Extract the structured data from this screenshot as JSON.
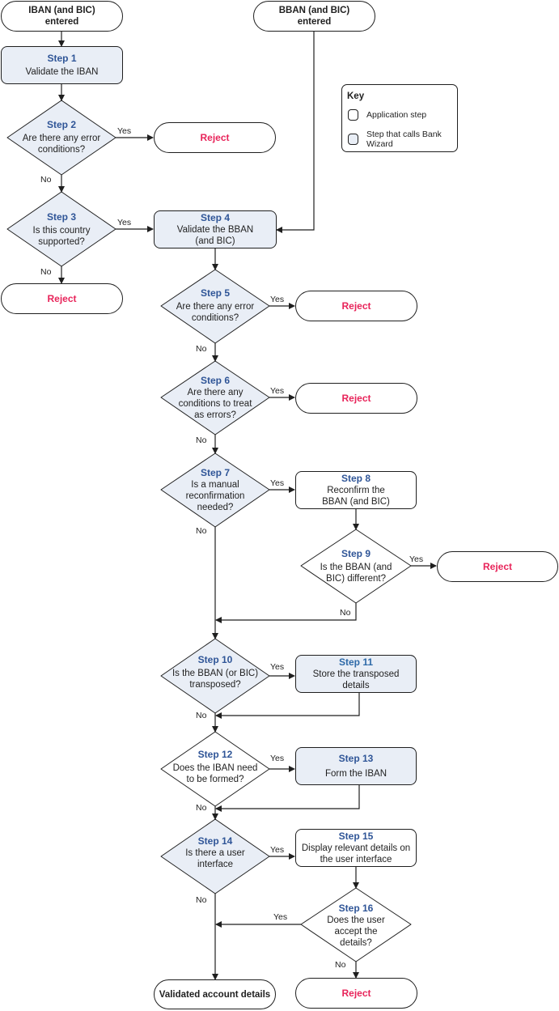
{
  "key": {
    "title": "Key",
    "items": [
      {
        "label": "Application step",
        "fill": "#ffffff"
      },
      {
        "label": "Step that calls Bank Wizard",
        "fill": "#e9eef6"
      }
    ]
  },
  "colors": {
    "bank_wizard_fill": "#e9eef6",
    "step_label": "#2f5597",
    "reject": "#e8245a",
    "line": "#1f1f1f"
  },
  "terminals": {
    "iban_entered": "IBAN (and BIC) entered",
    "bban_entered": "BBAN (and BIC) entered",
    "reject": "Reject",
    "validated": "Validated account details"
  },
  "edge_labels": {
    "yes": "Yes",
    "no": "No"
  },
  "steps": {
    "s1": {
      "step": "Step 1",
      "text": "Validate the IBAN",
      "type": "process",
      "calls_bank_wizard": true
    },
    "s2": {
      "step": "Step 2",
      "text": "Are there any error conditions?",
      "type": "decision",
      "calls_bank_wizard": true
    },
    "s3": {
      "step": "Step 3",
      "text": "Is this country supported?",
      "type": "decision",
      "calls_bank_wizard": true
    },
    "s4": {
      "step": "Step 4",
      "text": "Validate the BBAN (and BIC)",
      "type": "process",
      "calls_bank_wizard": true
    },
    "s5": {
      "step": "Step 5",
      "text": "Are there any error conditions?",
      "type": "decision",
      "calls_bank_wizard": true
    },
    "s6": {
      "step": "Step 6",
      "text": "Are there any conditions to treat as errors?",
      "type": "decision",
      "calls_bank_wizard": true
    },
    "s7": {
      "step": "Step 7",
      "text": "Is a manual reconfirmation needed?",
      "type": "decision",
      "calls_bank_wizard": true
    },
    "s8": {
      "step": "Step 8",
      "text": "Reconfirm the BBAN (and BIC)",
      "type": "process",
      "calls_bank_wizard": false
    },
    "s9": {
      "step": "Step 9",
      "text": "Is the BBAN (and BIC) different?",
      "type": "decision",
      "calls_bank_wizard": false
    },
    "s10": {
      "step": "Step 10",
      "text": "Is the BBAN (or BIC) transposed?",
      "type": "decision",
      "calls_bank_wizard": true
    },
    "s11": {
      "step": "Step 11",
      "text": "Store the transposed details",
      "type": "process",
      "calls_bank_wizard": true
    },
    "s12": {
      "step": "Step 12",
      "text": "Does the IBAN need to be formed?",
      "type": "decision",
      "calls_bank_wizard": false
    },
    "s13": {
      "step": "Step 13",
      "text": "Form the IBAN",
      "type": "process",
      "calls_bank_wizard": true
    },
    "s14": {
      "step": "Step 14",
      "text": "Is there a user interface",
      "type": "decision",
      "calls_bank_wizard": true
    },
    "s15": {
      "step": "Step 15",
      "text": "Display relevant details on the user interface",
      "type": "process",
      "calls_bank_wizard": false
    },
    "s16": {
      "step": "Step 16",
      "text": "Does the user accept the details?",
      "type": "decision",
      "calls_bank_wizard": false
    }
  }
}
